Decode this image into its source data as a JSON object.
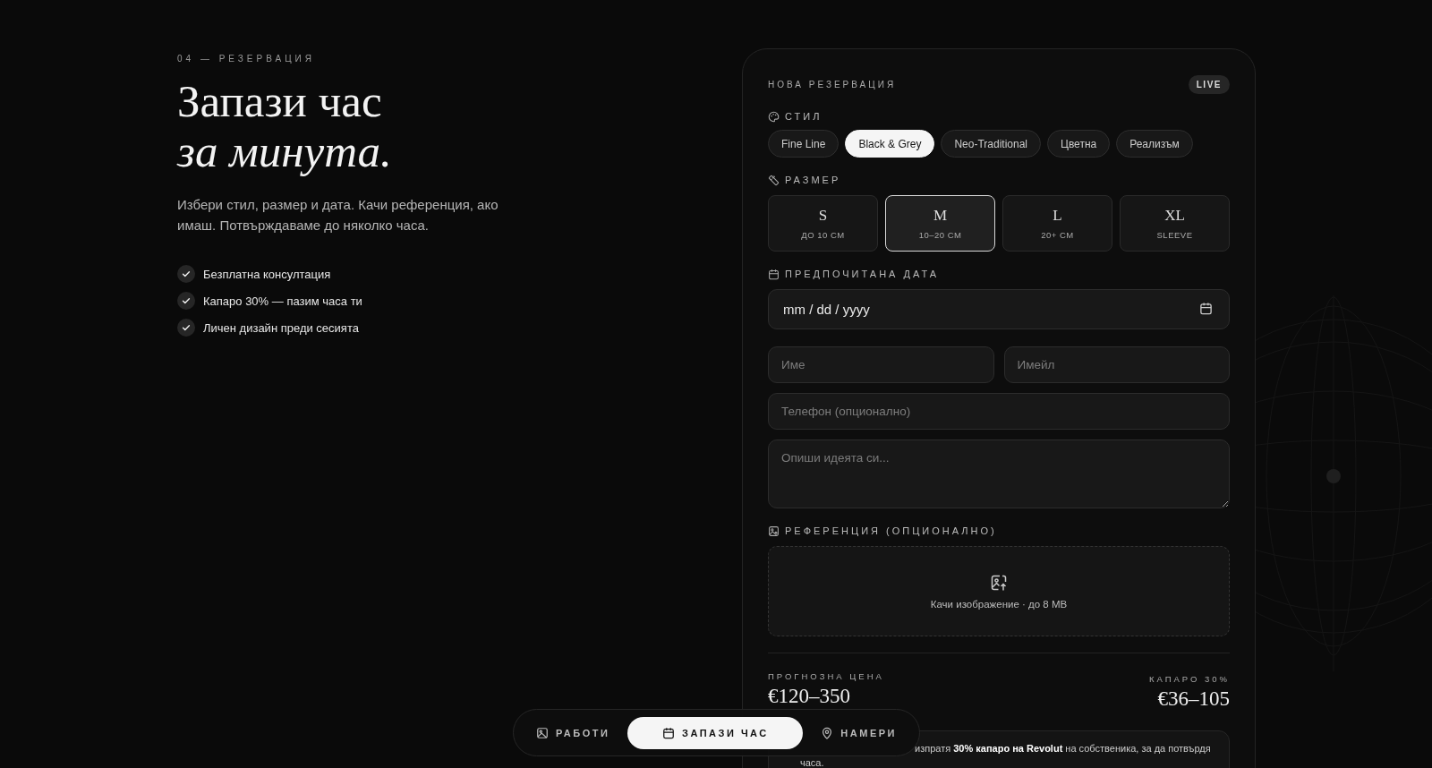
{
  "section": {
    "eyebrow": "04 — РЕЗЕРВАЦИЯ",
    "title_lines": [
      {
        "text": "Запази час",
        "italic": false
      },
      {
        "text": "за минута.",
        "italic": true
      }
    ],
    "lead": "Избери стил, размер и дата. Качи референция, ако имаш. Потвърждаваме до няколко часа.",
    "perks": [
      "Безплатна консултация",
      "Капаро 30% — пазим часа ти",
      "Личен дизайн преди сесията"
    ]
  },
  "form": {
    "title": "НОВА РЕЗЕРВАЦИЯ",
    "badge": "LIVE",
    "style": {
      "label": "СТИЛ",
      "options": [
        {
          "label": "Fine Line",
          "selected": false
        },
        {
          "label": "Black & Grey",
          "selected": true
        },
        {
          "label": "Neo-Traditional",
          "selected": false
        },
        {
          "label": "Цветна",
          "selected": false
        },
        {
          "label": "Реализъм",
          "selected": false
        }
      ]
    },
    "size": {
      "label": "РАЗМЕР",
      "options": [
        {
          "letter": "S",
          "range": "ДО 10 СМ",
          "selected": false
        },
        {
          "letter": "M",
          "range": "10–20 СМ",
          "selected": true
        },
        {
          "letter": "L",
          "range": "20+ СМ",
          "selected": false
        },
        {
          "letter": "XL",
          "range": "SLEEVE",
          "selected": false
        }
      ]
    },
    "date": {
      "label": "ПРЕДПОЧИТАНА ДАТА",
      "placeholder": "mm / dd / yyyy"
    },
    "name": {
      "placeholder": "Име"
    },
    "email": {
      "placeholder": "Имейл"
    },
    "phone": {
      "placeholder": "Телефон (опционално)"
    },
    "idea": {
      "placeholder": "Опиши идеята си..."
    },
    "reference": {
      "label": "РЕФЕРЕНЦИЯ (ОПЦИОНАЛНО)",
      "upload_text": "Качи изображение · до 8 MB"
    },
    "price": {
      "label": "ПРОГНОЗНА ЦЕНА",
      "value": "€120–350"
    },
    "deposit": {
      "label": "КАПАРО 30%",
      "value": "€36–105"
    },
    "note_lines": [
      "изпратя **30% капаро на Revolut** на собственика, за да потвърдя",
      "часа."
    ]
  },
  "nav": [
    {
      "label": "РАБОТИ",
      "kind": "works",
      "selected": false
    },
    {
      "label": "ЗАПАЗИ ЧАС",
      "kind": "booking",
      "selected": true
    },
    {
      "label": "НАМЕРИ",
      "kind": "location",
      "selected": false
    }
  ]
}
